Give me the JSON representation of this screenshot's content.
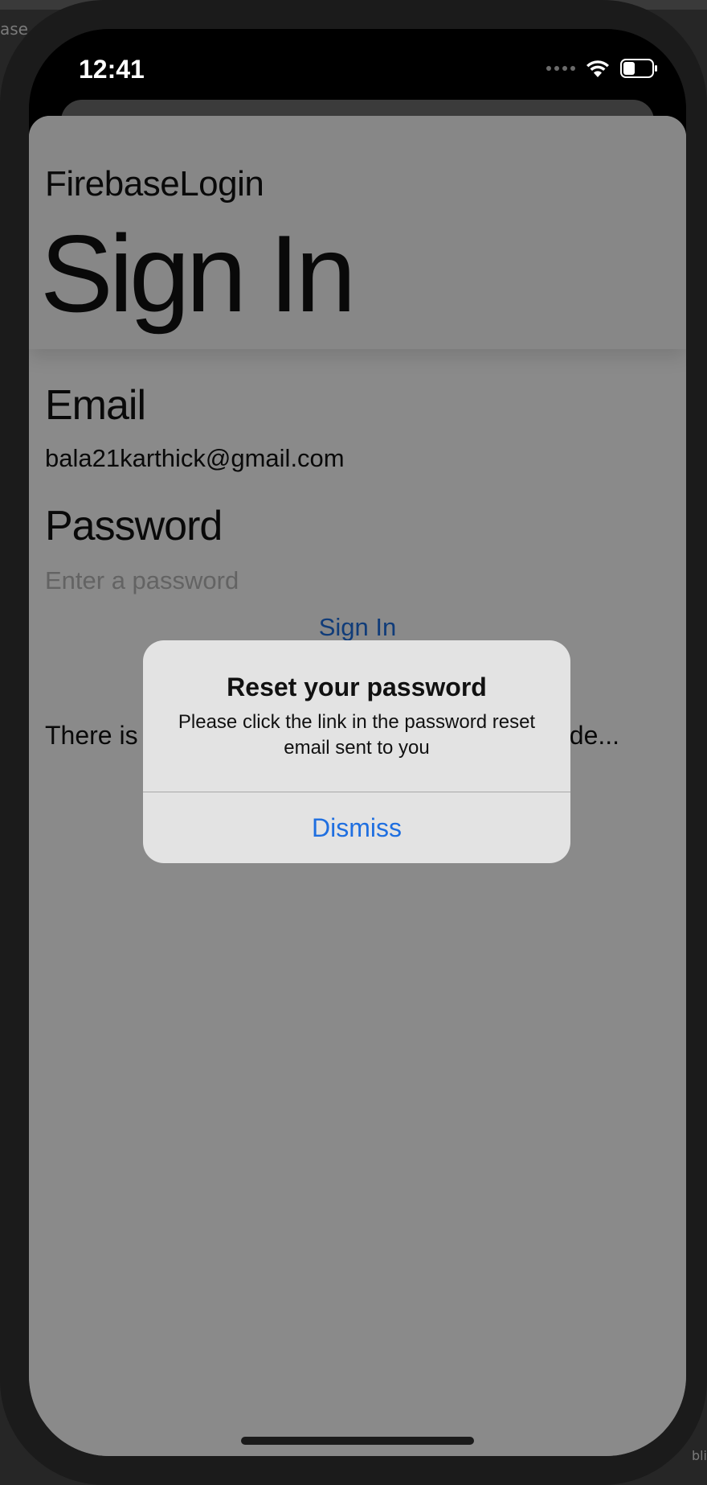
{
  "desktop": {
    "left_fragment": "ase",
    "right_fragment": "bli"
  },
  "status_bar": {
    "time": "12:41",
    "icons": [
      "signal-icon",
      "wifi-icon",
      "battery-icon"
    ]
  },
  "header": {
    "app_name": "FirebaseLogin",
    "title": "Sign In"
  },
  "form": {
    "email_label": "Email",
    "email_value": "bala21karthick@gmail.com",
    "password_label": "Password",
    "password_placeholder": "Enter a password",
    "sign_in_label": "Sign In"
  },
  "message": "There is no user record corresponding to this ide...",
  "alert": {
    "title": "Reset your password",
    "message": "Please click the link in the password reset email sent to you",
    "button_label": "Dismiss"
  },
  "colors": {
    "accent": "#1f6fe0",
    "overlay": "#000000",
    "alert_background": "#e3e3e3"
  }
}
